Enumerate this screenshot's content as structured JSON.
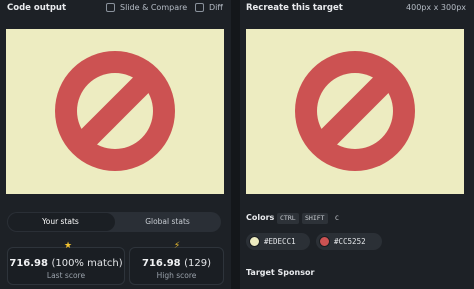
{
  "left": {
    "title": "Code output",
    "slide_compare_label": "Slide & Compare",
    "diff_label": "Diff",
    "tabs": [
      {
        "label": "Your stats",
        "active": true
      },
      {
        "label": "Global stats",
        "active": false
      }
    ],
    "stats": [
      {
        "value": "716.98",
        "detail": "(100% match)",
        "label": "Last score",
        "icon": "star-icon"
      },
      {
        "value": "716.98",
        "detail": "(129)",
        "label": "High score",
        "icon": "lightning-icon"
      }
    ]
  },
  "right": {
    "title": "Recreate this target",
    "dimensions": "400px x 300px",
    "colors_title": "Colors",
    "shortcut_keys": [
      "CTRL",
      "SHIFT",
      "C"
    ],
    "colors": [
      {
        "hex": "#EDECC1",
        "label": "#EDECC1"
      },
      {
        "hex": "#CC5252",
        "label": "#CC5252"
      }
    ],
    "sponsor_title": "Target Sponsor"
  },
  "canvas": {
    "background": "#EDECC1",
    "symbol_color": "#CC5252",
    "icon": "no-entry-icon"
  }
}
